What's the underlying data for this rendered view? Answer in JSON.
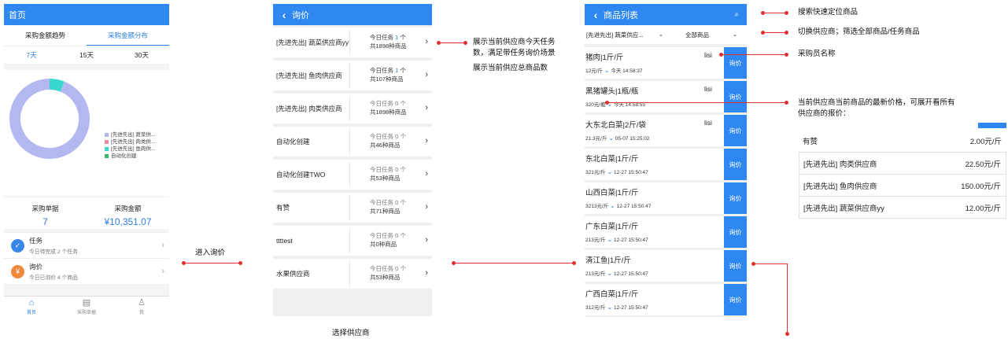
{
  "screen_home": {
    "title": "首页",
    "tabs": [
      "采购金额趋势",
      "采购金额分布"
    ],
    "ranges": [
      "7天",
      "15天",
      "30天"
    ],
    "legend": [
      {
        "label": "[先进先出] 蔬菜供...",
        "color": "#b4b8f0"
      },
      {
        "label": "[先进先出] 肉类供...",
        "color": "#f08aa0"
      },
      {
        "label": "[先进先出] 鱼肉供...",
        "color": "#3ad6d0"
      },
      {
        "label": "自动化创建",
        "color": "#36b86a"
      }
    ],
    "donut_share": {
      "main": 0.94,
      "second": 0.06
    },
    "stats": [
      {
        "label": "采购单据",
        "value": "7"
      },
      {
        "label": "采购金额",
        "value": "¥10,351.07"
      }
    ],
    "rows": [
      {
        "title": "任务",
        "sub": "今日待完成 2 个任务",
        "icon": "check-calendar-icon",
        "color": "#3a86e6"
      },
      {
        "title": "询价",
        "sub": "今日已询价 4 个商品",
        "icon": "quote-icon",
        "color": "#f0883a"
      }
    ],
    "nav": [
      {
        "label": "首页",
        "icon": "home-icon"
      },
      {
        "label": "采购单据",
        "icon": "document-icon"
      },
      {
        "label": "我",
        "icon": "person-icon"
      }
    ]
  },
  "screen_inquiry": {
    "title": "询价",
    "suppliers": [
      {
        "name": "[先进先出] 蔬菜供应商yy",
        "tasks": "今日任务 ",
        "task_count": "1",
        "task_unit": " 个",
        "goods": "共1898种商品",
        "highlight": true
      },
      {
        "name": "[先进先出] 鱼肉供应商",
        "tasks": "今日任务 ",
        "task_count": "1",
        "task_unit": " 个",
        "goods": "共107种商品",
        "highlight": true
      },
      {
        "name": "[先进先出] 肉类供应商",
        "tasks": "今日任务 ",
        "task_count": "0",
        "task_unit": " 个",
        "goods": "共1898种商品",
        "highlight": false
      },
      {
        "name": "自动化创建",
        "tasks": "今日任务 ",
        "task_count": "0",
        "task_unit": " 个",
        "goods": "共46种商品",
        "highlight": false
      },
      {
        "name": "自动化创建TWO",
        "tasks": "今日任务 ",
        "task_count": "0",
        "task_unit": " 个",
        "goods": "共53种商品",
        "highlight": false
      },
      {
        "name": "有赞",
        "tasks": "今日任务 ",
        "task_count": "0",
        "task_unit": " 个",
        "goods": "共71种商品",
        "highlight": false
      },
      {
        "name": "ttttest",
        "tasks": "今日任务 ",
        "task_count": "0",
        "task_unit": " 个",
        "goods": "共0种商品",
        "highlight": false
      },
      {
        "name": "水果供应商",
        "tasks": "今日任务 ",
        "task_count": "0",
        "task_unit": " 个",
        "goods": "共53种商品",
        "highlight": false
      }
    ]
  },
  "screen_products": {
    "title": "商品列表",
    "supplier_filter": "[先进先出] 蔬菜供应...",
    "goods_filter": "全部商品",
    "button_label": "询价",
    "products": [
      {
        "name": "猪肉|1斤/斤",
        "price": "12元/斤",
        "time": "今天 14:58:37",
        "buyer": "lisi"
      },
      {
        "name": "黑猪罐头|1瓶/瓶",
        "price": "320元/瓶",
        "time": "今天 14:58:55",
        "buyer": "lisi"
      },
      {
        "name": "大东北白菜|2斤/袋",
        "price": "21.3元/斤",
        "time": "05-07 15:25:02",
        "buyer": "lisi"
      },
      {
        "name": "东北白菜|1斤/斤",
        "price": "321元/斤",
        "time": "12-27 15:50:47",
        "buyer": ""
      },
      {
        "name": "山西白菜|1斤/斤",
        "price": "3213元/斤",
        "time": "12-27 15:50:47",
        "buyer": ""
      },
      {
        "name": "广东白菜|1斤/斤",
        "price": "213元/斤",
        "time": "12-27 15:50:47",
        "buyer": ""
      },
      {
        "name": "清江鱼|1斤/斤",
        "price": "213元/斤",
        "time": "12-27 15:50:47",
        "buyer": ""
      },
      {
        "name": "广西白菜|1斤/斤",
        "price": "312元/斤",
        "time": "12-27 15:50:47",
        "buyer": ""
      }
    ]
  },
  "price_popup": {
    "rows": [
      {
        "supplier": "有赞",
        "price": "2.00元/斤"
      },
      {
        "supplier": "[先进先出] 肉类供应商",
        "price": "22.50元/斤"
      },
      {
        "supplier": "[先进先出] 鱼肉供应商",
        "price": "150.00元/斤"
      },
      {
        "supplier": "[先进先出] 蔬菜供应商yy",
        "price": "12.00元/斤"
      }
    ]
  },
  "annotations": {
    "enter_inquiry": "进入询价",
    "select_supplier": "选择供应商",
    "task_note": "展示当前供应商今天任务数，满足带任务询价场景",
    "goods_note": "展示当前供应总商品数",
    "search_note": "搜索快速定位商品",
    "switch_note": "切换供应商；筛选全部商品/任务商品",
    "buyer_note": "采购员名称",
    "price_note": "当前供应商当前商品的最新价格，可展开看所有供应商的报价："
  }
}
